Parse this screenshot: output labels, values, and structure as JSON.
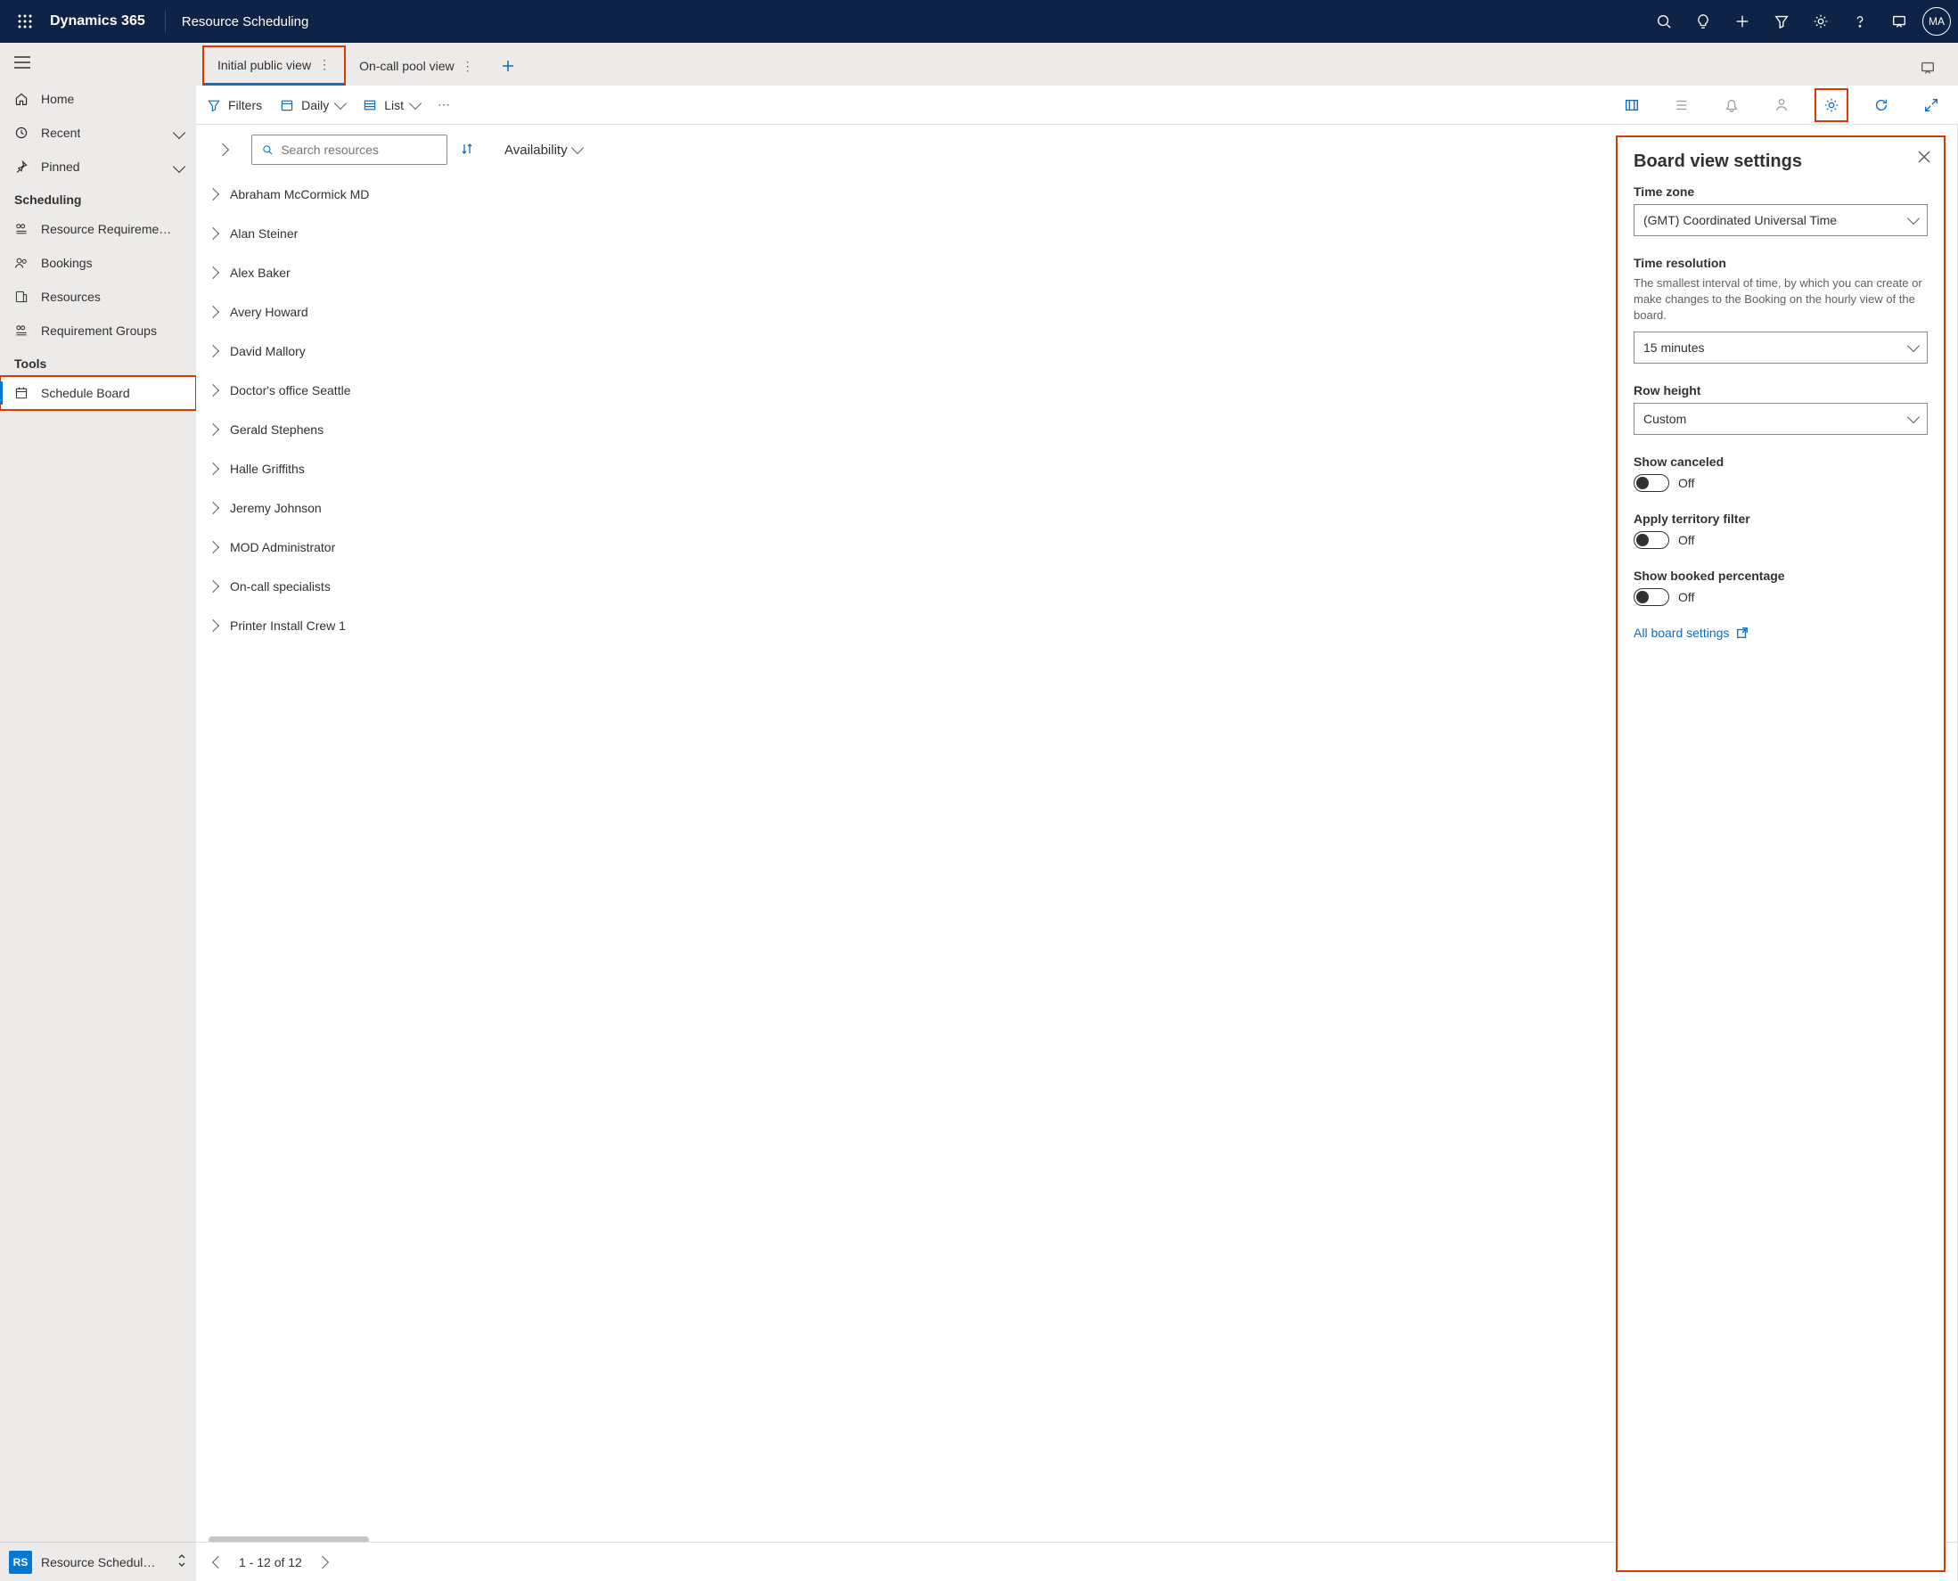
{
  "header": {
    "brand": "Dynamics 365",
    "app_name": "Resource Scheduling",
    "avatar_initials": "MA"
  },
  "sidebar": {
    "items_top": [
      {
        "label": "Home",
        "icon": "home"
      },
      {
        "label": "Recent",
        "icon": "recent",
        "expandable": true
      },
      {
        "label": "Pinned",
        "icon": "pin",
        "expandable": true
      }
    ],
    "section_scheduling": "Scheduling",
    "items_scheduling": [
      {
        "label": "Resource Requireme…"
      },
      {
        "label": "Bookings"
      },
      {
        "label": "Resources"
      },
      {
        "label": "Requirement Groups"
      }
    ],
    "section_tools": "Tools",
    "items_tools": [
      {
        "label": "Schedule Board",
        "selected": true
      }
    ],
    "bottom_tile": "RS",
    "bottom_label": "Resource Schedul…"
  },
  "tabs": [
    {
      "label": "Initial public view",
      "active": true
    },
    {
      "label": "On-call pool view",
      "active": false
    }
  ],
  "commandbar": {
    "filters": "Filters",
    "daily": "Daily",
    "list": "List"
  },
  "search": {
    "placeholder": "Search resources",
    "availability_label": "Availability"
  },
  "resources": [
    "Abraham McCormick MD",
    "Alan Steiner",
    "Alex Baker",
    "Avery Howard",
    "David Mallory",
    "Doctor's office Seattle",
    "Gerald Stephens",
    "Halle Griffiths",
    "Jeremy Johnson",
    "MOD Administrator",
    "On-call specialists",
    "Printer Install Crew 1"
  ],
  "pager": {
    "range": "1 - 12 of 12"
  },
  "panel": {
    "title": "Board view settings",
    "timezone_label": "Time zone",
    "timezone_value": "(GMT) Coordinated Universal Time",
    "timeres_label": "Time resolution",
    "timeres_hint": "The smallest interval of time, by which you can create or make changes to the Booking on the hourly view of the board.",
    "timeres_value": "15 minutes",
    "rowheight_label": "Row height",
    "rowheight_value": "Custom",
    "show_canceled_label": "Show canceled",
    "show_canceled_state": "Off",
    "territory_label": "Apply territory filter",
    "territory_state": "Off",
    "booked_label": "Show booked percentage",
    "booked_state": "Off",
    "all_settings": "All board settings"
  }
}
